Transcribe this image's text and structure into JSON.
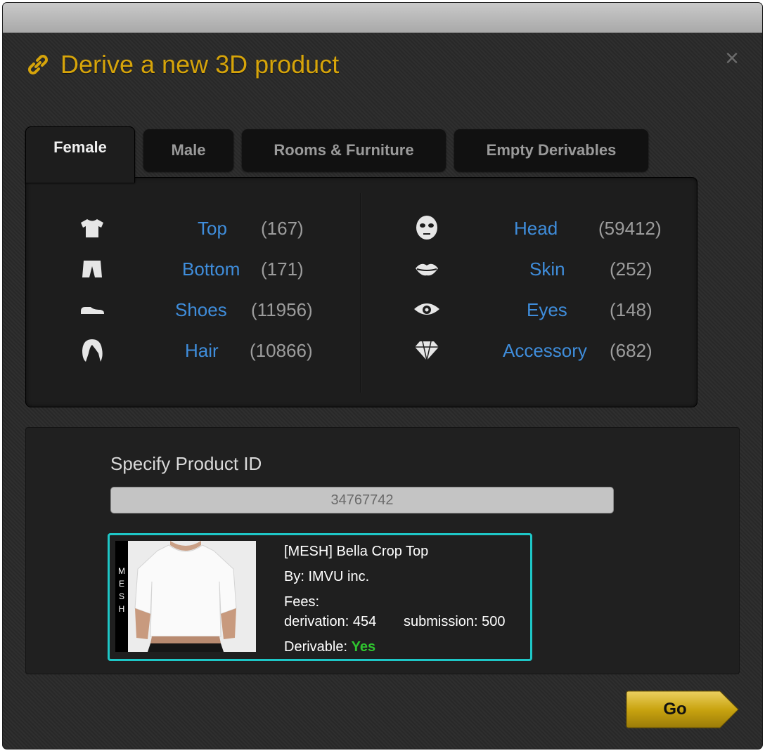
{
  "dialog": {
    "title": "Derive a new 3D product",
    "close_icon": "close-icon",
    "link_icon": "link-icon"
  },
  "tabs": [
    {
      "label": "Female",
      "active": true
    },
    {
      "label": "Male",
      "active": false
    },
    {
      "label": "Rooms & Furniture",
      "active": false
    },
    {
      "label": "Empty Derivables",
      "active": false
    }
  ],
  "categories": {
    "left": [
      {
        "label": "Top",
        "count": "(167)",
        "icon": "shirt-icon"
      },
      {
        "label": "Bottom",
        "count": "(171)",
        "icon": "pants-icon"
      },
      {
        "label": "Shoes",
        "count": "(11956)",
        "icon": "shoe-icon"
      },
      {
        "label": "Hair",
        "count": "(10866)",
        "icon": "hair-icon"
      }
    ],
    "right": [
      {
        "label": "Head",
        "count": "(59412)",
        "icon": "head-icon"
      },
      {
        "label": "Skin",
        "count": "(252)",
        "icon": "lips-icon"
      },
      {
        "label": "Eyes",
        "count": "(148)",
        "icon": "eye-icon"
      },
      {
        "label": "Accessory",
        "count": "(682)",
        "icon": "diamond-icon"
      }
    ]
  },
  "specify": {
    "label": "Specify Product ID",
    "value": "34767742"
  },
  "product": {
    "name": "[MESH] Bella Crop Top",
    "by": "By: IMVU inc.",
    "fees_label": "Fees:",
    "derivation": "derivation: 454",
    "submission": "submission: 500",
    "derivable_label": "Derivable:",
    "derivable_value": "Yes",
    "mesh_badge": [
      "M",
      "E",
      "S",
      "H"
    ]
  },
  "go_button": {
    "label": "Go"
  },
  "colors": {
    "title": "#d6a40a",
    "link": "#3f8ddb",
    "card_border": "#1ec7c7",
    "yes": "#2fc42f",
    "go_button": "#c9a410"
  }
}
